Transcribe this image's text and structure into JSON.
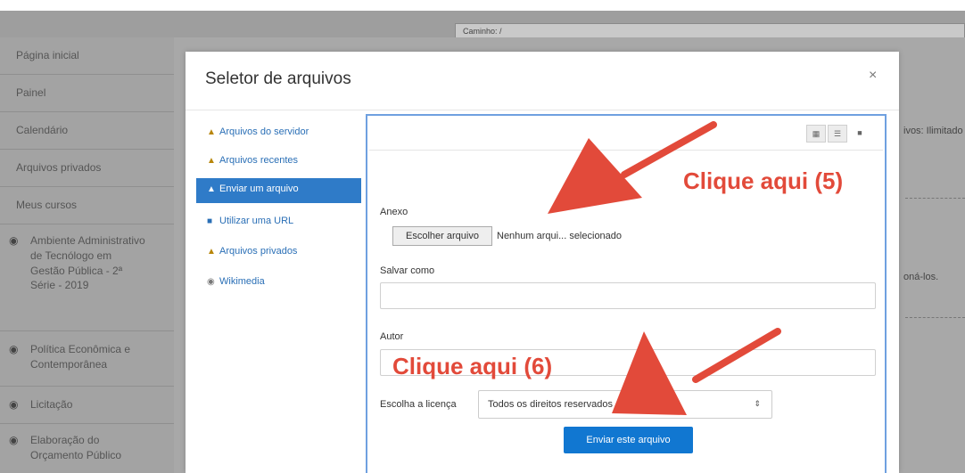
{
  "background": {
    "path_label": "Caminho: /",
    "right_text_1": "ivos: Ilimitado",
    "right_text_2": "oná-los."
  },
  "sidebar": {
    "items": [
      "Página inicial",
      "Painel",
      "Calendário",
      "Arquivos privados",
      "Meus cursos"
    ],
    "courses": [
      "Ambiente Administrativo de Tecnólogo em Gestão Pública - 2ª Série - 2019",
      "Política Econômica e Contemporânea",
      "Licitação",
      "Elaboração do Orçamento Público"
    ]
  },
  "modal": {
    "title": "Seletor de arquivos",
    "close": "×",
    "repositories": [
      {
        "label": "Arquivos do servidor",
        "icon": "folder-icon"
      },
      {
        "label": "Arquivos recentes",
        "icon": "folder-icon"
      },
      {
        "label": "Enviar um arquivo",
        "icon": "upload-icon",
        "active": true
      },
      {
        "label": "Utilizar uma URL",
        "icon": "link-icon"
      },
      {
        "label": "Arquivos privados",
        "icon": "folder-icon"
      },
      {
        "label": "Wikimedia",
        "icon": "wikimedia-icon"
      }
    ],
    "view_buttons": [
      "grid-view-icon",
      "list-view-icon",
      "folder-view-icon"
    ],
    "form": {
      "attachment_label": "Anexo",
      "choose_button": "Escolher arquivo",
      "no_file_text": "Nenhum arqui... selecionado",
      "save_as_label": "Salvar como",
      "save_as_value": "",
      "author_label": "Autor",
      "author_value": "",
      "license_label": "Escolha a licença",
      "license_value": "Todos os direitos reservados",
      "submit_button": "Enviar este arquivo"
    }
  },
  "annotations": {
    "callout_5": "Clique aqui (5)",
    "callout_6": "Clique aqui (6)",
    "arrow_color": "#e24a3a"
  }
}
